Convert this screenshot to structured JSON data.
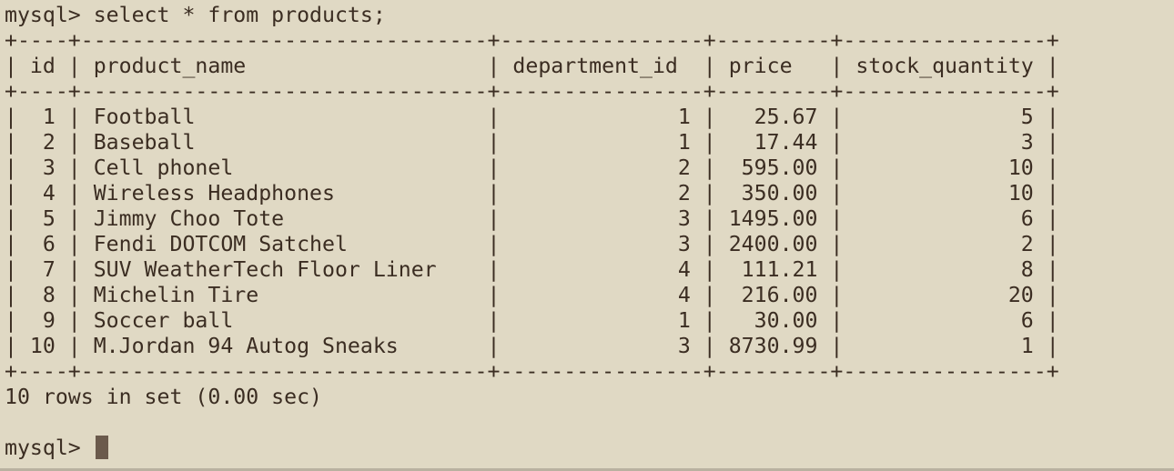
{
  "terminal": {
    "command_line": "mysql> select * from products;",
    "border": "+----+--------------------------------+----------------+---------+----------------+",
    "header_row": "| id | product_name                   | department_id  | price   | stock_quantity |",
    "rows": [
      "|  1 | Football                       |              1 |   25.67 |              5 |",
      "|  2 | Baseball                       |              1 |   17.44 |              3 |",
      "|  3 | Cell phonel                    |              2 |  595.00 |             10 |",
      "|  4 | Wireless Headphones            |              2 |  350.00 |             10 |",
      "|  5 | Jimmy Choo Tote                |              3 | 1495.00 |              6 |",
      "|  6 | Fendi DOTCOM Satchel           |              3 | 2400.00 |              2 |",
      "|  7 | SUV WeatherTech Floor Liner    |              4 |  111.21 |              8 |",
      "|  8 | Michelin Tire                  |              4 |  216.00 |             20 |",
      "|  9 | Soccer ball                    |              1 |   30.00 |              6 |",
      "| 10 | M.Jordan 94 Autog Sneaks       |              3 | 8730.99 |              1 |"
    ],
    "result_summary": "10 rows in set (0.00 sec)",
    "prompt": "mysql> "
  },
  "table": {
    "columns": [
      "id",
      "product_name",
      "department_id",
      "price",
      "stock_quantity"
    ],
    "records": [
      [
        "1",
        "Football",
        "1",
        "25.67",
        "5"
      ],
      [
        "2",
        "Baseball",
        "1",
        "17.44",
        "3"
      ],
      [
        "3",
        "Cell phonel",
        "2",
        "595.00",
        "10"
      ],
      [
        "4",
        "Wireless Headphones",
        "2",
        "350.00",
        "10"
      ],
      [
        "5",
        "Jimmy Choo Tote",
        "3",
        "1495.00",
        "6"
      ],
      [
        "6",
        "Fendi DOTCOM Satchel",
        "3",
        "2400.00",
        "2"
      ],
      [
        "7",
        "SUV WeatherTech Floor Liner",
        "4",
        "111.21",
        "8"
      ],
      [
        "8",
        "Michelin Tire",
        "4",
        "216.00",
        "20"
      ],
      [
        "9",
        "Soccer ball",
        "1",
        "30.00",
        "6"
      ],
      [
        "10",
        "M.Jordan 94 Autog Sneaks",
        "3",
        "8730.99",
        "1"
      ]
    ]
  },
  "colors": {
    "background": "#e0d9c4",
    "text": "#3b2d22",
    "cursor": "#6b5a4c"
  },
  "icons": {
    "cursor": "block-cursor-icon"
  }
}
